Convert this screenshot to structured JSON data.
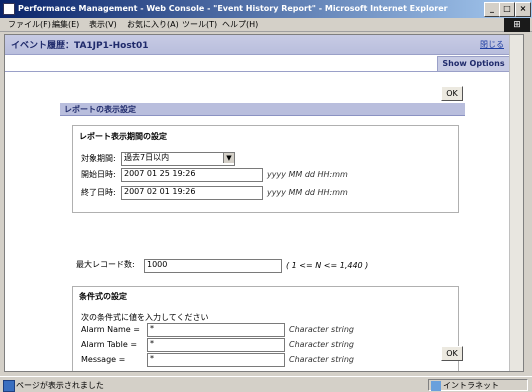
{
  "window": {
    "title": "Performance Management - Web Console - \"Event History Report\" - Microsoft Internet Explorer"
  },
  "menu": [
    "ファイル(F)",
    "編集(E)",
    "表示(V)",
    "お気に入り(A)",
    "ツール(T)",
    "ヘルプ(H)"
  ],
  "header": {
    "title": "イベント履歴：TA1JP1-Host01",
    "close": "閉じる"
  },
  "show_options": "Show Options",
  "ok_label": "OK",
  "panel": {
    "title": "レポートの表示設定",
    "period": {
      "title": "レポート表示期間の設定",
      "target_label": "対象期間:",
      "target_value": "過去7日以内",
      "start_label": "開始日時:",
      "start_value": "2007 01 25 19:26",
      "end_label": "終了日時:",
      "end_value": "2007 02 01 19:26",
      "format_hint": "yyyy MM dd HH:mm"
    },
    "max_records": {
      "label": "最大レコード数:",
      "value": "1000",
      "hint": "( 1 <= N <= 1,440 )"
    },
    "conditions": {
      "title": "条件式の設定",
      "instruction": "次の条件式に値を入力してください",
      "rows": [
        {
          "label": "Alarm Name =",
          "value": "*",
          "hint": "Character string"
        },
        {
          "label": "Alarm Table =",
          "value": "*",
          "hint": "Character string"
        },
        {
          "label": "Message =",
          "value": "*",
          "hint": "Character string"
        }
      ]
    }
  },
  "status": {
    "text": "ページが表示されました",
    "zone": "イントラネット"
  }
}
